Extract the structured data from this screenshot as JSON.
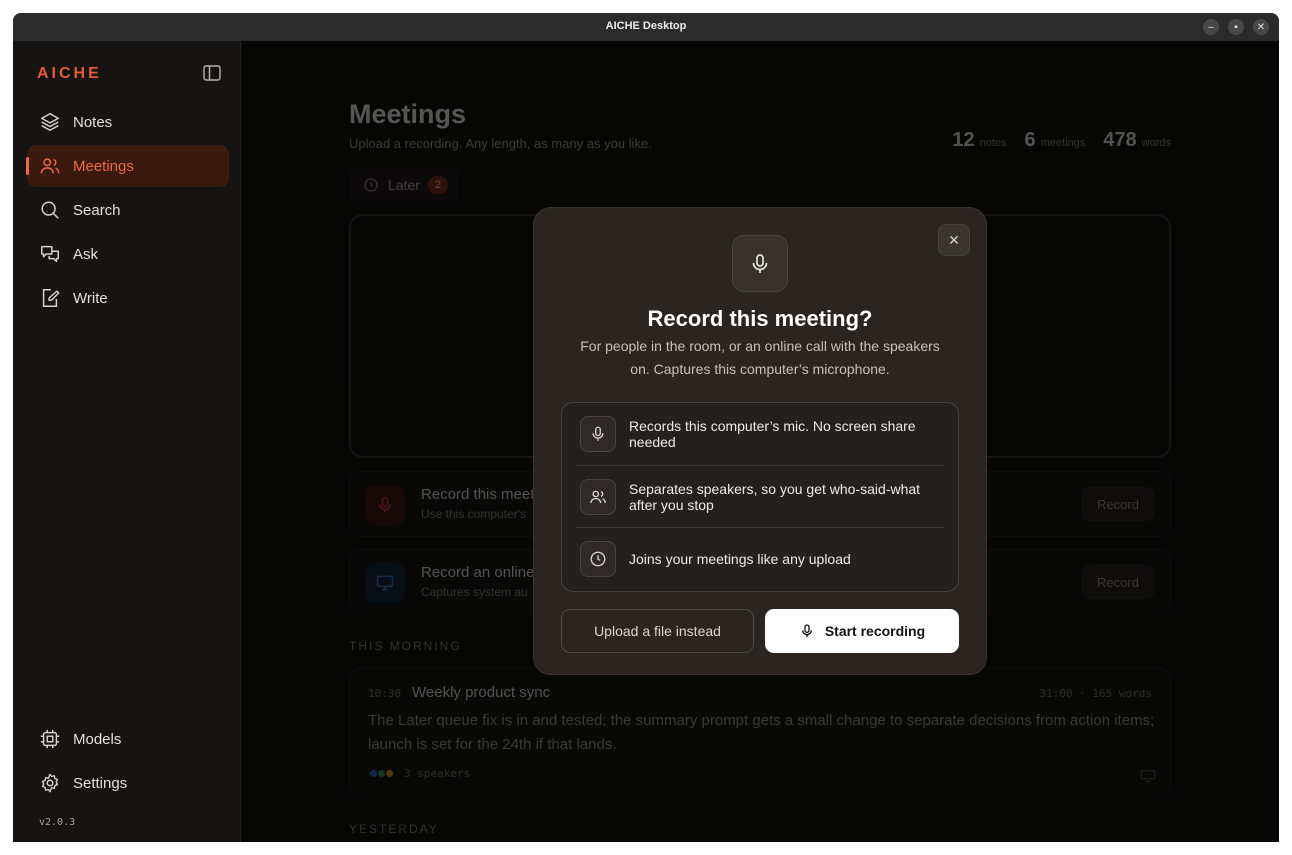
{
  "window": {
    "title": "AICHE Desktop"
  },
  "sidebar": {
    "logo": "AICHE",
    "items": [
      {
        "label": "Notes",
        "icon": "layers-icon"
      },
      {
        "label": "Meetings",
        "icon": "users-icon",
        "active": true
      },
      {
        "label": "Search",
        "icon": "search-icon"
      },
      {
        "label": "Ask",
        "icon": "chat-icon"
      },
      {
        "label": "Write",
        "icon": "edit-icon"
      }
    ],
    "bottom": [
      {
        "label": "Models",
        "icon": "chip-icon"
      },
      {
        "label": "Settings",
        "icon": "gear-icon"
      }
    ],
    "version": "v2.0.3"
  },
  "main": {
    "title": "Meetings",
    "subtitle": "Upload a recording. Any length, as many as you like.",
    "stats": [
      {
        "value": "12",
        "label": "notes"
      },
      {
        "value": "6",
        "label": "meetings"
      },
      {
        "value": "478",
        "label": "words"
      }
    ],
    "later": {
      "label": "Later",
      "count": "2"
    },
    "options": [
      {
        "title": "Record this meet",
        "subtitle": "Use this computer's",
        "button": "Record"
      },
      {
        "title": "Record an online",
        "subtitle": "Captures system au",
        "button": "Record"
      }
    ],
    "sections": {
      "morning": "THIS MORNING",
      "yesterday": "YESTERDAY"
    },
    "meeting": {
      "time": "10:30",
      "title": "Weekly product sync",
      "meta": "31:00 · 165 words",
      "summary": "The Later queue fix is in and tested; the summary prompt gets a small change to separate decisions from action items; launch is set for the 24th if that lands.",
      "speakers": "3 speakers"
    }
  },
  "modal": {
    "title": "Record this meeting?",
    "description": "For people in the room, or an online call with the speakers on. Captures this computer’s microphone.",
    "features": [
      {
        "text": "Records this computer’s mic. No screen share needed",
        "icon": "mic-icon"
      },
      {
        "text": "Separates speakers, so you get who-said-what after you stop",
        "icon": "users-icon"
      },
      {
        "text": "Joins your meetings like any upload",
        "icon": "clock-icon"
      }
    ],
    "secondary_button": "Upload a file instead",
    "primary_button": "Start recording"
  },
  "colors": {
    "accent": "#ef6a3c",
    "record_red": "#e0362c",
    "online_blue": "#2f7fd6"
  }
}
